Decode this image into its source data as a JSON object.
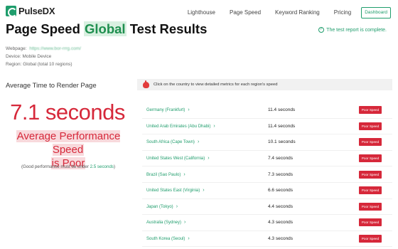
{
  "brand": {
    "name": "PulseDX",
    "accent": "#1f9d6c",
    "danger": "#d6283a"
  },
  "nav": {
    "items": [
      "Lighthouse",
      "Page Speed",
      "Keyword Ranking",
      "Pricing"
    ],
    "dashboard": "Dashboard"
  },
  "title": {
    "before": "Page Speed ",
    "highlight": "Global",
    "after": " Test Results"
  },
  "status": {
    "text": "The test report is complete.",
    "icon": "check-circle-icon"
  },
  "meta": {
    "webpage_label": "Webpage:",
    "webpage_url": "https://www.bor-rrrg.com/",
    "device": "Device: Mobile Device",
    "region": "Region: Global (total 10 regions)"
  },
  "summary": {
    "heading": "Average Time to Render Page",
    "time": "7.1 seconds",
    "verdict_line1": "Average Performance Speed",
    "verdict_line2": "is Poor",
    "note_before": "(Good performance must be under ",
    "note_value": "2.5 seconds",
    "note_after": ")"
  },
  "banner": {
    "text": "Click on the country to view detailed metrics for each region's speed",
    "icon": "hand-pointer-icon"
  },
  "results": [
    {
      "region": "Germany (Frankfurt)",
      "time": "11.4 seconds",
      "badge": "Poor Speed"
    },
    {
      "region": "United Arab Emirates (Abu Dhabi)",
      "time": "11.4 seconds",
      "badge": "Poor Speed"
    },
    {
      "region": "South Africa (Cape Town)",
      "time": "10.1 seconds",
      "badge": "Poor Speed"
    },
    {
      "region": "United States West (California)",
      "time": "7.4 seconds",
      "badge": "Poor Speed"
    },
    {
      "region": "Brazil (Sao Paulo)",
      "time": "7.3 seconds",
      "badge": "Poor Speed"
    },
    {
      "region": "United States East (Virginia)",
      "time": "6.6 seconds",
      "badge": "Poor Speed"
    },
    {
      "region": "Japan (Tokyo)",
      "time": "4.4 seconds",
      "badge": "Poor Speed"
    },
    {
      "region": "Australia (Sydney)",
      "time": "4.3 seconds",
      "badge": "Poor Speed"
    },
    {
      "region": "South Korea (Seoul)",
      "time": "4.3 seconds",
      "badge": "Poor Speed"
    }
  ]
}
